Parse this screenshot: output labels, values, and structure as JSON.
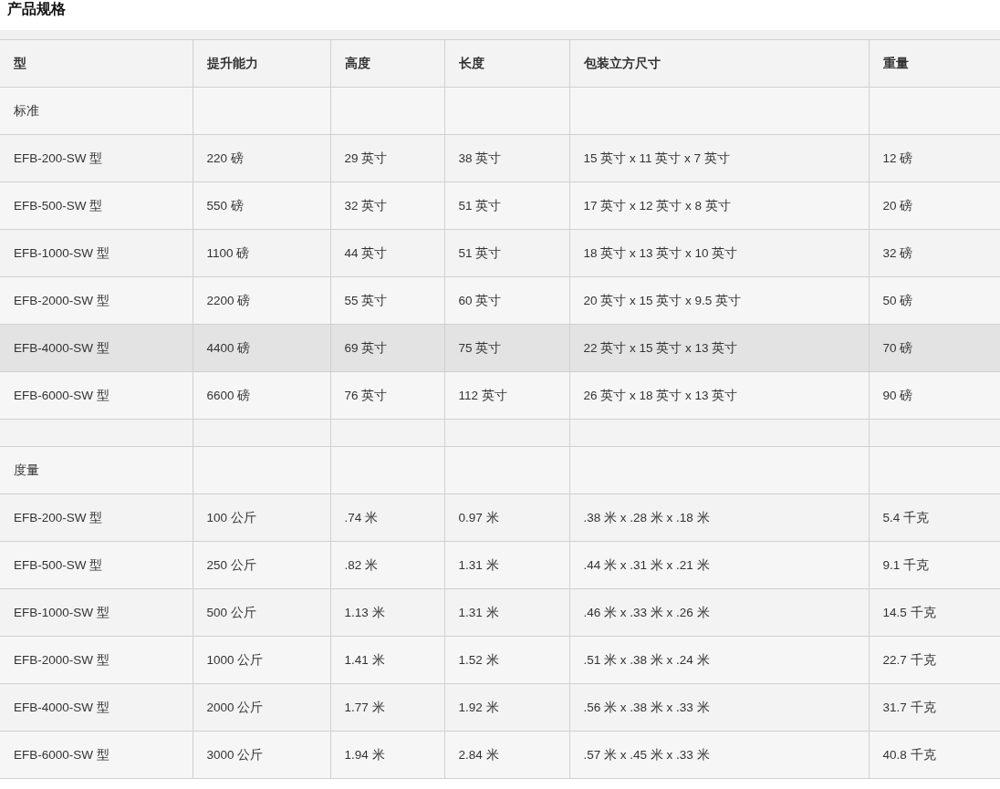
{
  "title": "产品规格",
  "table": {
    "columns": [
      "型",
      "提升能力",
      "高度",
      "长度",
      "包装立方尺寸",
      "重量"
    ],
    "rows": [
      {
        "kind": "section",
        "selected": false,
        "label": "标准"
      },
      {
        "kind": "data",
        "selected": false,
        "cells": [
          "EFB-200-SW 型",
          "220 磅",
          "29 英寸",
          "38 英寸",
          "15 英寸 x 11 英寸 x 7 英寸",
          "12 磅"
        ]
      },
      {
        "kind": "data",
        "selected": false,
        "cells": [
          "EFB-500-SW 型",
          "550 磅",
          "32 英寸",
          "51 英寸",
          "17 英寸 x 12 英寸 x 8 英寸",
          "20 磅"
        ]
      },
      {
        "kind": "data",
        "selected": false,
        "cells": [
          "EFB-1000-SW 型",
          "1100 磅",
          "44 英寸",
          "51 英寸",
          "18 英寸 x 13 英寸 x 10 英寸",
          "32 磅"
        ]
      },
      {
        "kind": "data",
        "selected": false,
        "cells": [
          "EFB-2000-SW 型",
          "2200 磅",
          "55 英寸",
          "60 英寸",
          "20 英寸 x 15 英寸 x 9.5 英寸",
          "50 磅"
        ]
      },
      {
        "kind": "data",
        "selected": true,
        "cells": [
          "EFB-4000-SW 型",
          "4400 磅",
          "69 英寸",
          "75 英寸",
          "22 英寸 x 15 英寸 x 13 英寸",
          "70 磅"
        ]
      },
      {
        "kind": "data",
        "selected": false,
        "cells": [
          "EFB-6000-SW 型",
          "6600 磅",
          "76 英寸",
          "112 英寸",
          "26 英寸 x 18 英寸 x 13 英寸",
          "90 磅"
        ]
      },
      {
        "kind": "spacer",
        "selected": false
      },
      {
        "kind": "section",
        "selected": false,
        "label": "度量"
      },
      {
        "kind": "data",
        "selected": false,
        "cells": [
          "EFB-200-SW 型",
          "100 公斤",
          ".74 米",
          "0.97 米",
          ".38 米 x .28 米 x .18 米",
          "5.4 千克"
        ]
      },
      {
        "kind": "data",
        "selected": false,
        "cells": [
          "EFB-500-SW 型",
          "250 公斤",
          ".82 米",
          "1.31 米",
          ".44 米 x .31 米 x .21 米",
          "9.1 千克"
        ]
      },
      {
        "kind": "data",
        "selected": false,
        "cells": [
          "EFB-1000-SW 型",
          "500 公斤",
          "1.13 米",
          "1.31 米",
          ".46 米 x .33 米 x .26 米",
          "14.5 千克"
        ]
      },
      {
        "kind": "data",
        "selected": false,
        "cells": [
          "EFB-2000-SW 型",
          "1000 公斤",
          "1.41 米",
          "1.52 米",
          ".51 米 x .38 米 x .24 米",
          "22.7 千克"
        ]
      },
      {
        "kind": "data",
        "selected": false,
        "cells": [
          "EFB-4000-SW 型",
          "2000 公斤",
          "1.77 米",
          "1.92 米",
          ".56 米 x .38 米 x .33 米",
          "31.7 千克"
        ]
      },
      {
        "kind": "data",
        "selected": false,
        "cells": [
          "EFB-6000-SW 型",
          "3000 公斤",
          "1.94 米",
          "2.84 米",
          ".57 米 x .45 米 x .33 米",
          "40.8 千克"
        ]
      }
    ]
  }
}
